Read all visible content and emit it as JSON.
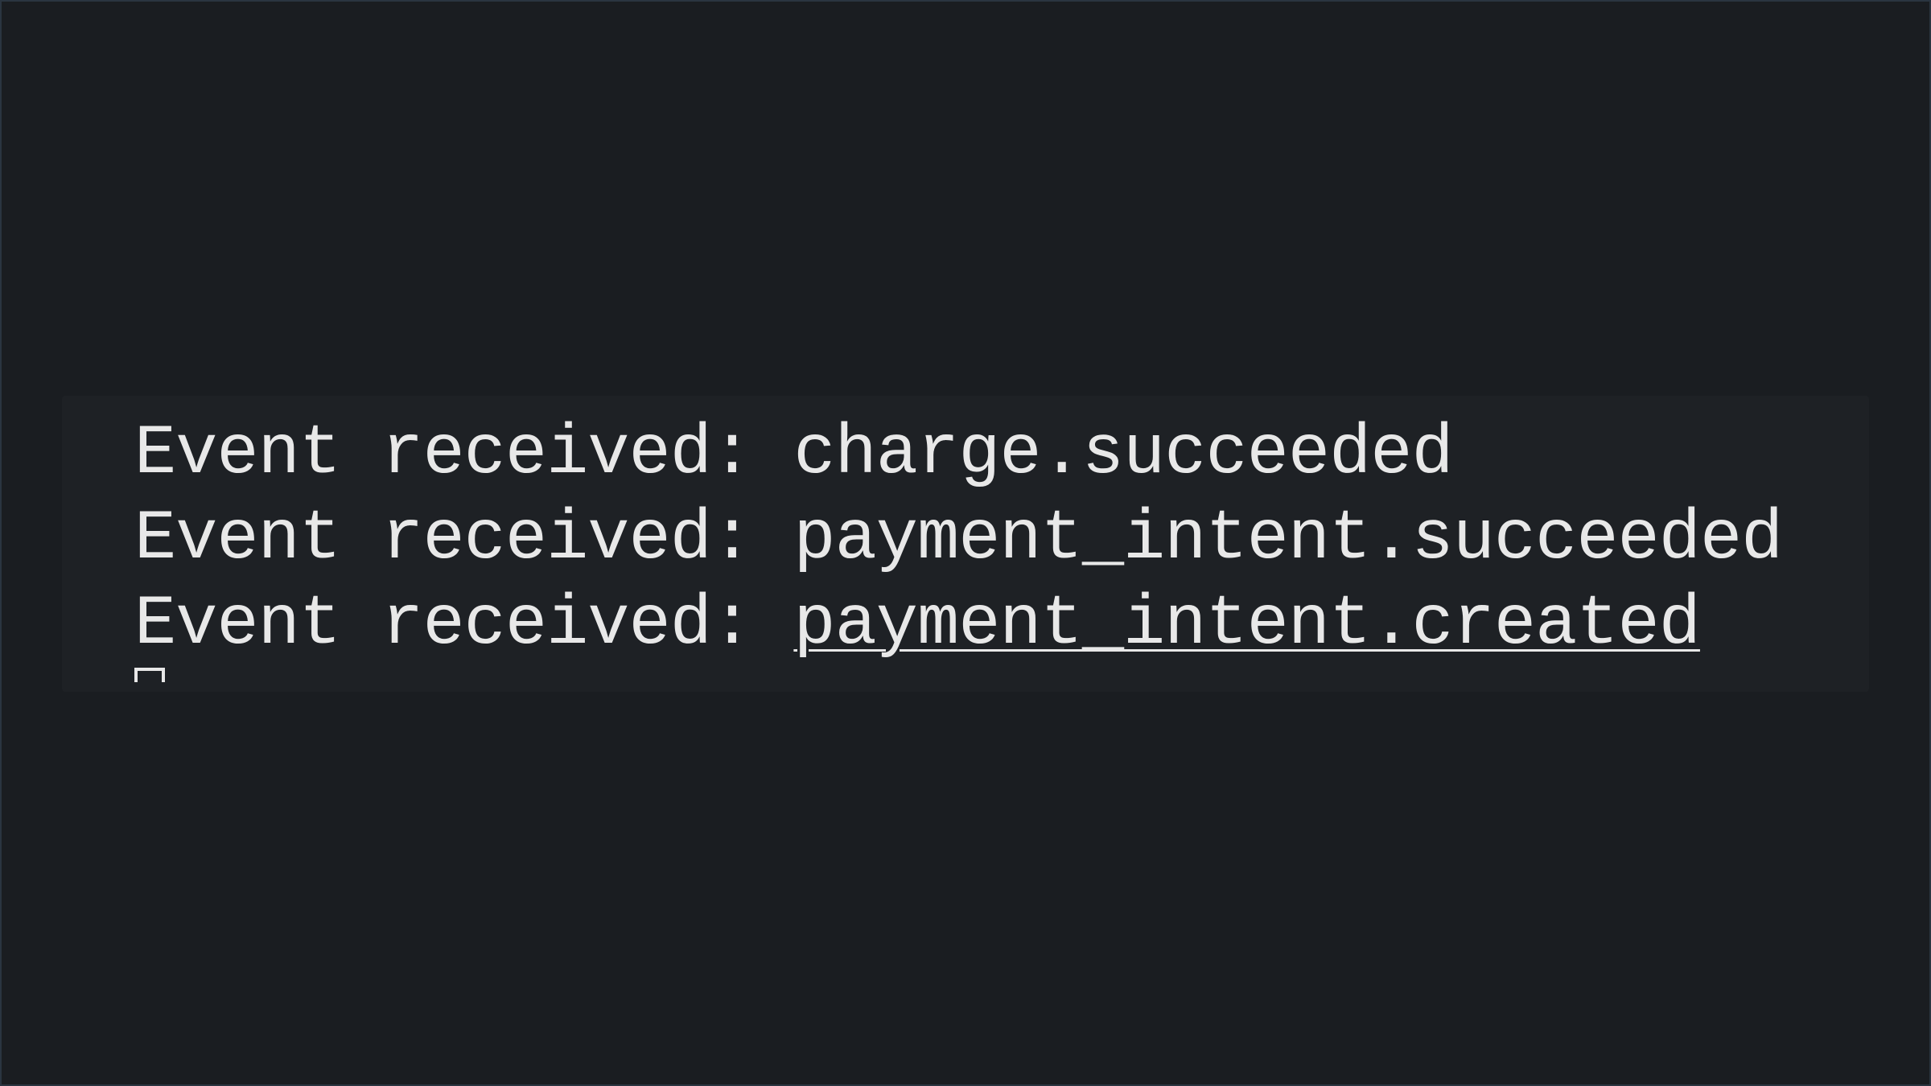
{
  "log": {
    "prefix": "Event received:",
    "lines": [
      {
        "event": "charge.succeeded",
        "linked": false
      },
      {
        "event": "payment_intent.succeeded",
        "linked": false
      },
      {
        "event": "payment_intent.created",
        "linked": true
      }
    ]
  }
}
